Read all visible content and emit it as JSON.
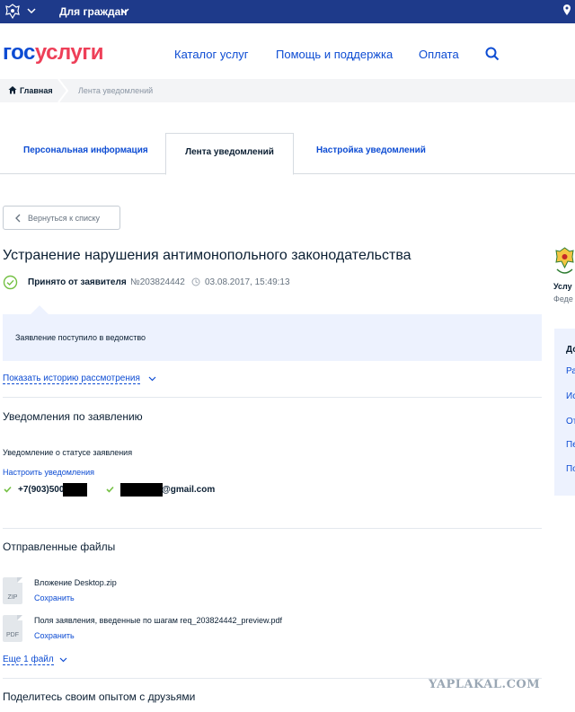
{
  "topbar": {
    "citizens_label": "Для граждан"
  },
  "logo": {
    "part1": "гос",
    "part2": "услуги"
  },
  "nav": {
    "catalog": "Каталог услуг",
    "help": "Помощь и поддержка",
    "payment": "Оплата"
  },
  "breadcrumbs": {
    "home": "Главная",
    "current": "Лента уведомлений"
  },
  "tabs": [
    {
      "label": "Персональная информация"
    },
    {
      "label": "Лента уведомлений"
    },
    {
      "label": "Настройка уведомлений"
    }
  ],
  "back_button": "Вернуться к списку",
  "title": "Устранение нарушения антимонопольного законодательства",
  "status": {
    "text": "Принято от заявителя",
    "number": "№203824442",
    "datetime": "03.08.2017, 15:49:13"
  },
  "info_message": "Заявление поступило в ведомство",
  "history_link": "Показать историю рассмотрения",
  "notifications": {
    "section_title": "Уведомления по заявлению",
    "status_label": "Уведомление о статусе заявления",
    "configure_link": "Настроить уведомления",
    "phone": "+7(903)500",
    "email": "@gmail.com"
  },
  "files": {
    "section_title": "Отправленные файлы",
    "items": [
      {
        "ext": "ZIP",
        "name": "Вложение Desktop.zip",
        "action": "Сохранить"
      },
      {
        "ext": "PDF",
        "name": "Поля заявления, введенные по шагам req_203824442_preview.pdf",
        "action": "Сохранить"
      }
    ],
    "more_link": "Еще 1 файл"
  },
  "share_title": "Поделитесь своим опытом с друзьями",
  "sidebar": {
    "title_fragment": "Услу",
    "subtitle_fragment": "Феде",
    "panel_head": "До",
    "items": [
      "Ра",
      "Ис",
      "От",
      "Пе",
      "По"
    ]
  },
  "watermark": "YAPLAKAL.COM",
  "colors": {
    "topbar": "#1e3a8a",
    "link": "#0d4cd3",
    "logo_red": "#ee3f58",
    "info_bg": "#edf2fe"
  }
}
